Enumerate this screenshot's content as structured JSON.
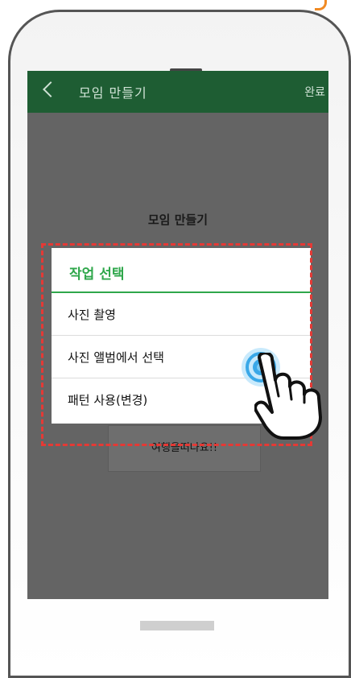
{
  "app_bar": {
    "title": "모임 만들기",
    "done_label": "완료"
  },
  "background": {
    "title": "모임 만들기",
    "card_text": "여행을떠나요!!"
  },
  "dialog": {
    "title": "작업 선택",
    "items": [
      {
        "label": "사진 촬영"
      },
      {
        "label": "사진 앨범에서 선택"
      },
      {
        "label": "패턴 사용(변경)"
      }
    ]
  },
  "colors": {
    "app_bar": "#1e5d33",
    "accent": "#2fa74b",
    "overlay": "#646464",
    "highlight": "#e53935",
    "tap_ring": "#3aa8e8"
  },
  "icons": {
    "back": "chevron-left-icon",
    "pointer": "hand-pointer-icon",
    "tap": "tap-ripple-icon"
  }
}
